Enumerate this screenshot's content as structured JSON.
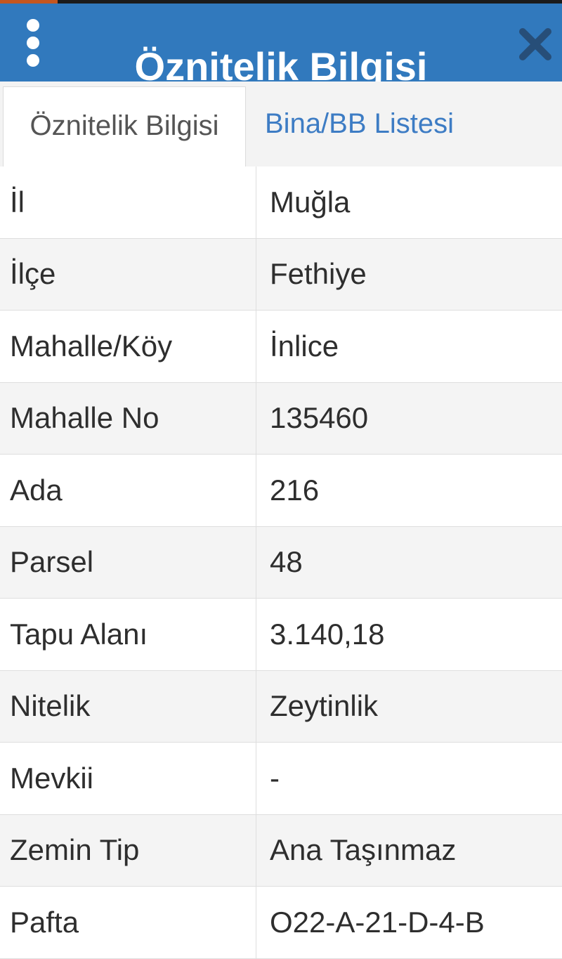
{
  "header": {
    "title": "Öznitelik Bilgisi",
    "menu_icon": "more-vert-icon",
    "close_icon": "close-icon",
    "background_color": "#3179bd"
  },
  "tabs": [
    {
      "label": "Öznitelik Bilgisi",
      "active": true
    },
    {
      "label": "Bina/BB Listesi",
      "active": false
    }
  ],
  "colors": {
    "tab_inactive_text": "#3d7cc4",
    "text": "#2e2e2e"
  },
  "attributes": [
    {
      "label": "İl",
      "value": "Muğla"
    },
    {
      "label": "İlçe",
      "value": "Fethiye"
    },
    {
      "label": "Mahalle/Köy",
      "value": "İnlice"
    },
    {
      "label": "Mahalle No",
      "value": "135460"
    },
    {
      "label": "Ada",
      "value": "216"
    },
    {
      "label": "Parsel",
      "value": "48"
    },
    {
      "label": "Tapu Alanı",
      "value": "3.140,18"
    },
    {
      "label": "Nitelik",
      "value": "Zeytinlik"
    },
    {
      "label": "Mevkii",
      "value": "-"
    },
    {
      "label": "Zemin Tip",
      "value": "Ana Taşınmaz"
    },
    {
      "label": "Pafta",
      "value": "O22-A-21-D-4-B"
    }
  ]
}
